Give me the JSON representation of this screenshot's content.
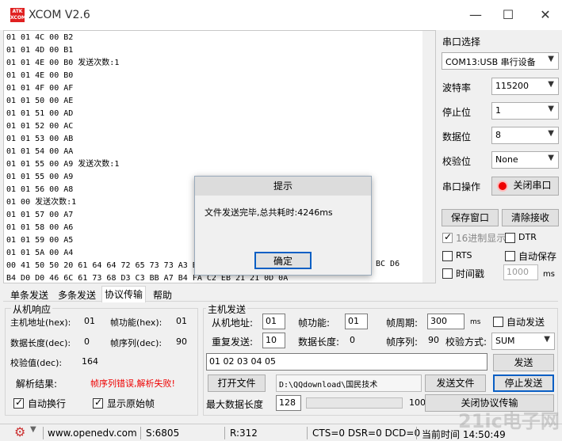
{
  "app": {
    "title": "XCOM V2.6",
    "logo": "ATK XCOM",
    "minimize_icon": "minimize-icon",
    "maximize_icon": "maximize-icon",
    "close_icon": "close-icon"
  },
  "receive_lines": [
    "01 01 4C 00 B2",
    "01 01 4D 00 B1",
    "01 01 4E 00 B0 发送次数:1",
    "01 01 4E 00 B0",
    "01 01 4F 00 AF",
    "01 01 50 00 AE",
    "01 01 51 00 AD",
    "01 01 52 00 AC",
    "01 01 53 00 AB",
    "01 01 54 00 AA",
    "01 01 55 00 A9 发送次数:1",
    "01 01 55 00 A9",
    "01 01 56 00 A8",
    "01 00 发送次数:1",
    "01 01 57 00 A7",
    "01 01 58 00 A6",
    "01 01 59 00 A5",
    "01 01 5A 00 A4",
    "00 41 50 50 20 61 64 64 72 65 73 73 A3 B",
    "B4 D0 D0 46 6C 61 73 68 D3 C3 BB A7 B4 FA C2 EB 21 21 0D 0A"
  ],
  "receive_tail": "BC D6",
  "serial": {
    "port_label": "串口选择",
    "port_value": "COM13:USB 串行设备",
    "baud_label": "波特率",
    "baud_value": "115200",
    "stop_label": "停止位",
    "stop_value": "1",
    "data_label": "数据位",
    "data_value": "8",
    "parity_label": "校验位",
    "parity_value": "None",
    "op_label": "串口操作",
    "op_button": "关闭串口",
    "save_window": "保存窗口",
    "clear_recv": "清除接收",
    "hex_display": "16进制显示",
    "dtr": "DTR",
    "rts": "RTS",
    "auto_save": "自动保存",
    "timestamp": "时间戳",
    "timestamp_value": "1000",
    "timestamp_unit": "ms"
  },
  "dialog": {
    "title": "提示",
    "message": "文件发送完毕,总共耗时:4246ms",
    "ok": "确定"
  },
  "tabs": [
    "单条发送",
    "多条发送",
    "协议传输",
    "帮助"
  ],
  "slave": {
    "title": "从机响应",
    "addr_label": "主机地址(hex):",
    "addr_value": "01",
    "func_label": "帧功能(hex):",
    "func_value": "01",
    "len_label": "数据长度(dec):",
    "len_value": "0",
    "seq_label": "帧序列(dec):",
    "seq_value": "90",
    "crc_label": "校验值(dec):",
    "crc_value": "164",
    "result_label": "解析结果:",
    "result_value": "帧序列错误,解析失败!",
    "auto_wrap": "自动换行",
    "show_raw": "显示原始帧"
  },
  "master": {
    "title": "主机发送",
    "addr_label": "从机地址:",
    "addr_value": "01",
    "func_label": "帧功能:",
    "func_value": "01",
    "period_label": "帧周期:",
    "period_value": "300",
    "period_unit": "ms",
    "auto_send": "自动发送",
    "repeat_label": "重复发送:",
    "repeat_value": "10",
    "len_label": "数据长度:",
    "len_value": "0",
    "seq_label": "帧序列:",
    "seq_value": "90",
    "check_label": "校验方式:",
    "check_value": "SUM",
    "data_value": "01 02 03 04 05",
    "send": "发送",
    "open_file": "打开文件",
    "file_path": "D:\\QQdownload\\国民技术",
    "send_file": "发送文件",
    "stop_send": "停止发送",
    "max_len_label": "最大数据长度",
    "max_len_value": "128",
    "progress_value": "100",
    "close_protocol": "关闭协议传输"
  },
  "status": {
    "gear_icon": "gear-icon",
    "url": "www.openedv.com",
    "sent": "S:6805",
    "received": "R:312",
    "lines": "CTS=0 DSR=0 DCD=0",
    "time": "当前时间 14:50:49"
  },
  "watermark": "21ic电子网"
}
